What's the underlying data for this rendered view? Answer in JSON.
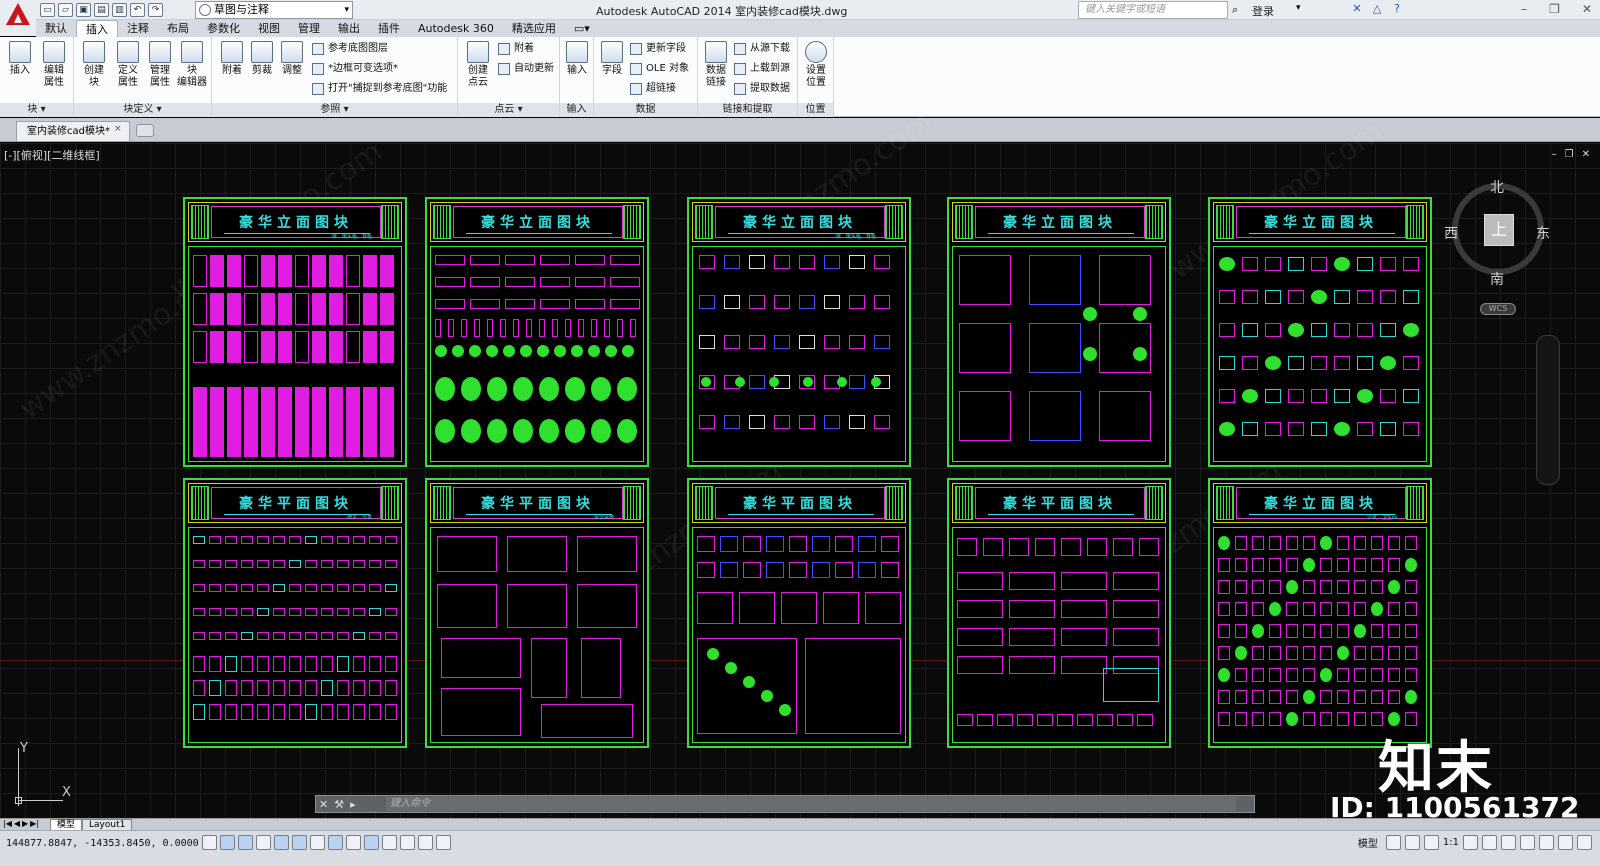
{
  "title_bar": {
    "app_title": "Autodesk AutoCAD 2014    室内装修cad模块.dwg",
    "workspace": "草图与注释",
    "search_placeholder": "键入关键字或短语",
    "login": "登录"
  },
  "menu_tabs": [
    "默认",
    "插入",
    "注释",
    "布局",
    "参数化",
    "视图",
    "管理",
    "输出",
    "插件",
    "Autodesk 360",
    "精选应用"
  ],
  "active_tab": "插入",
  "ribbon": {
    "block": {
      "insert": "插入",
      "edit_attr": "编辑\n属性",
      "title": "块 ▾"
    },
    "block_def": {
      "create": "创建\n块",
      "define_attr": "定义\n属性",
      "manage_attr": "管理\n属性",
      "block_editor": "块\n编辑器",
      "title": "块定义 ▾"
    },
    "reference": {
      "attach": "附着",
      "clip": "剪裁",
      "adjust": "调整",
      "underlay_layers": "参考底图图层",
      "frame_variable": "*边框可变选项*",
      "snap_underlay": "打开\"捕捉到参考底图\"功能",
      "title": "参照 ▾"
    },
    "point_cloud": {
      "create": "创建\n点云",
      "attach": "附着",
      "auto_update": "自动更新",
      "title": "点云 ▾"
    },
    "import": {
      "import": "输入",
      "title": "输入"
    },
    "data": {
      "field": "字段",
      "update_fields": "更新字段",
      "ole": "OLE 对象",
      "hyperlink": "超链接",
      "title": "数据"
    },
    "link_extract": {
      "data_link": "数据\n链接",
      "download": "从源下载",
      "upload": "上载到源",
      "extract": "提取数据",
      "title": "链接和提取"
    },
    "location": {
      "set_location": "设置\n位置",
      "title": "位置"
    }
  },
  "doc_tab": {
    "label": "室内装修cad模块*",
    "close": "×"
  },
  "viewport": {
    "label": "[-][俯视][二维线框]"
  },
  "sheets": [
    {
      "title": "豪华立面图块",
      "sub": "床、床头柜、背柜"
    },
    {
      "title": "豪华立面图块",
      "sub": ""
    },
    {
      "title": "豪华立面图块",
      "sub": "床、床头柜、背柜"
    },
    {
      "title": "豪华立面图块",
      "sub": ""
    },
    {
      "title": "豪华立面图块",
      "sub": ""
    },
    {
      "title": "豪华平面图块",
      "sub": "椅子、沙发"
    },
    {
      "title": "豪华平面图块",
      "sub": "会议桌椅"
    },
    {
      "title": "豪华平面图块",
      "sub": ""
    },
    {
      "title": "豪华平面图块",
      "sub": ""
    },
    {
      "title": "豪华立面图块",
      "sub": "沙发、卫生间"
    }
  ],
  "viewcube": {
    "north": "北",
    "south": "南",
    "west": "西",
    "east": "东",
    "top": "上",
    "wcs": "WCS"
  },
  "ucs": {
    "x": "X",
    "y": "Y"
  },
  "watermark": {
    "brand": "知末",
    "id": "ID: 1100561372",
    "site": "www.znzmo.com"
  },
  "command": {
    "placeholder": "键入命令"
  },
  "layout_tabs": [
    "模型",
    "Layout1"
  ],
  "status": {
    "coords": "144877.8847, -14353.8450, 0.0000",
    "model": "模型",
    "scale": "1:1"
  }
}
